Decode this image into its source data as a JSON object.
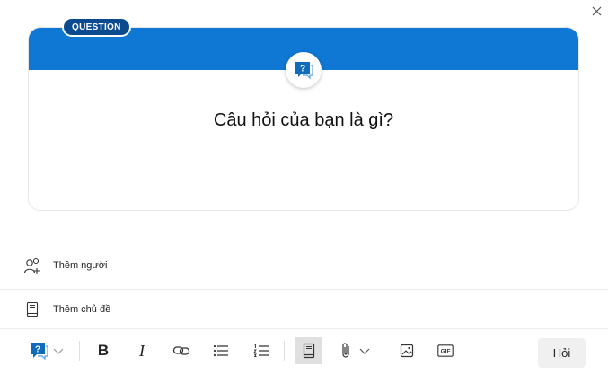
{
  "dialog": {
    "close_icon": "close-icon"
  },
  "card": {
    "badge": "QUESTION",
    "prompt": "Câu hỏi của bạn là gì?",
    "banner_color": "#0f78d4",
    "badge_color": "#0b4a8f",
    "icon": "question-bubble-icon"
  },
  "people": {
    "label": "Thêm người",
    "icon": "add-people-icon"
  },
  "topic": {
    "label": "Thêm chủ đề",
    "icon": "book-icon"
  },
  "toolbar": {
    "post_type_icon": "question-bubble-icon",
    "bold_label": "B",
    "italic_label": "I",
    "icons": [
      "chevron-down-icon",
      "link-icon",
      "bulleted-list-icon",
      "numbered-list-icon",
      "topic-book-icon",
      "attach-icon",
      "image-icon",
      "gif-icon"
    ],
    "gif_label": "GIF",
    "ask_label": "Hỏi"
  }
}
